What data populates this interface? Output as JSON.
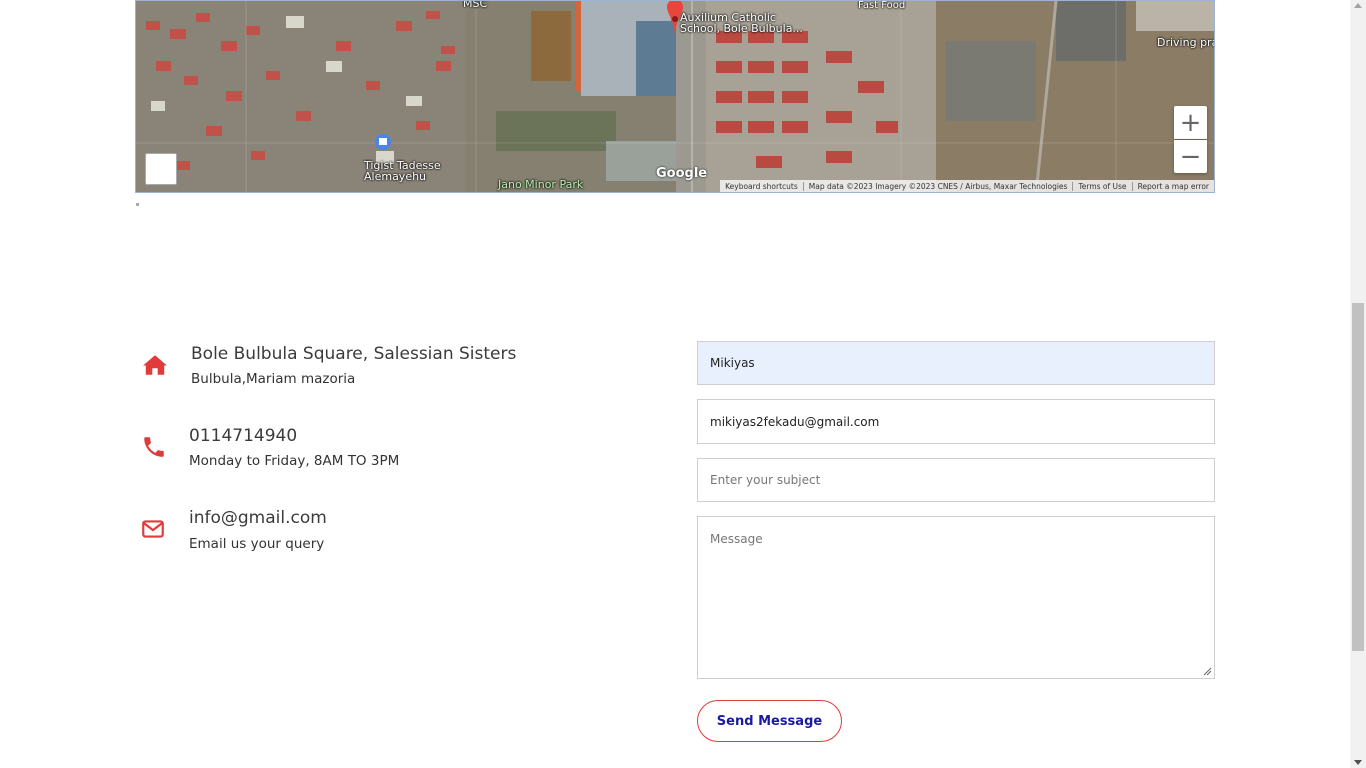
{
  "map": {
    "labels": {
      "msc": "MSC",
      "fast_food": "Fast Food",
      "school_line1": "Auxilium Catholic",
      "school_line2": "School, Bole Bulbula...",
      "driving": "Driving pra",
      "tigist_line1": "Tigist Tadesse",
      "tigist_line2": "Alemayehu",
      "park": "Jano Minor Park"
    },
    "google": "Google",
    "zoom_in": "+",
    "zoom_out": "−",
    "attribution": {
      "shortcuts": "Keyboard shortcuts",
      "map_data": "Map data ©2023 Imagery ©2023 CNES / Airbus, Maxar Technologies",
      "terms": "Terms of Use",
      "report": "Report a map error"
    }
  },
  "contact_info": [
    {
      "icon": "home-icon",
      "title": "Bole Bulbula Square, Salessian Sisters",
      "subtitle": "Bulbula,Mariam mazoria"
    },
    {
      "icon": "phone-icon",
      "title": "0114714940",
      "subtitle": "Monday to Friday, 8AM TO 3PM"
    },
    {
      "icon": "envelope-icon",
      "title": "info@gmail.com",
      "subtitle": "Email us your query"
    }
  ],
  "form": {
    "name_value": "Mikiyas",
    "email_value": "mikiyas2fekadu@gmail.com",
    "subject_placeholder": "Enter your subject",
    "message_placeholder": "Message",
    "send_label": "Send Message"
  },
  "colors": {
    "accent_red": "#e03a3a",
    "button_text": "#1a1aa6",
    "autofill_bg": "#e8f0fe"
  }
}
